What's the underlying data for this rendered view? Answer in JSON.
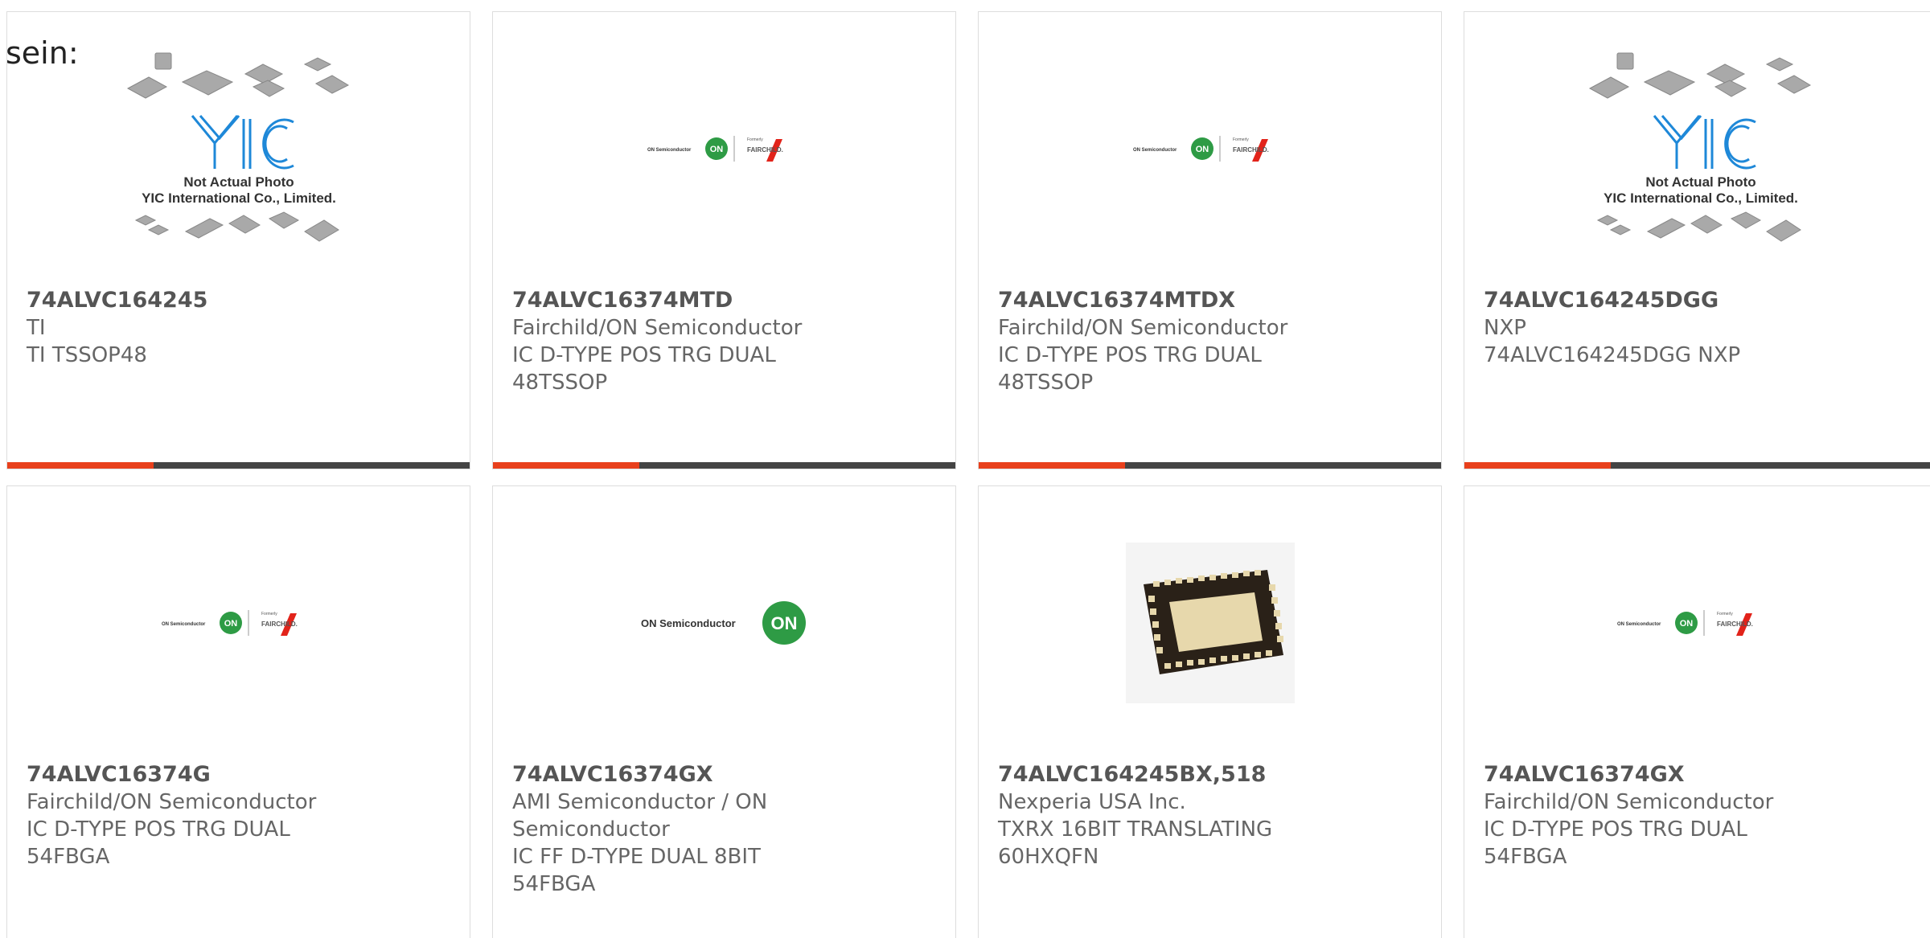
{
  "header": {
    "label": "sein:"
  },
  "placeholder": {
    "logo_text": "YIC",
    "line1": "Not Actual Photo",
    "line2": "YIC International Co., Limited."
  },
  "on_logo": {
    "company": "ON Semiconductor",
    "badge": "ON",
    "formerly": "Formerly",
    "fairchild": "FAIRCHILD."
  },
  "colors": {
    "accent": "#e8401c",
    "bar": "#444444",
    "on_green": "#2e9b45",
    "fairchild_red": "#e2231a"
  },
  "products": [
    {
      "part": "74ALVC164245",
      "maker": "TI",
      "desc": "TI TSSOP48",
      "image": "yic-placeholder"
    },
    {
      "part": "74ALVC16374MTD",
      "maker": "Fairchild/ON Semiconductor",
      "desc": "IC D-TYPE POS TRG DUAL 48TSSOP",
      "image": "on-fairchild-logo"
    },
    {
      "part": "74ALVC16374MTDX",
      "maker": "Fairchild/ON Semiconductor",
      "desc": "IC D-TYPE POS TRG DUAL 48TSSOP",
      "image": "on-fairchild-logo"
    },
    {
      "part": "74ALVC164245DGG",
      "maker": "NXP",
      "desc": "74ALVC164245DGG NXP",
      "image": "yic-placeholder"
    },
    {
      "part": "74ALVC16374G",
      "maker": "Fairchild/ON Semiconductor",
      "desc": "IC D-TYPE POS TRG DUAL 54FBGA",
      "image": "on-fairchild-logo"
    },
    {
      "part": "74ALVC16374GX",
      "maker": "AMI Semiconductor / ON Semiconductor",
      "desc": "IC FF D-TYPE DUAL 8BIT 54FBGA",
      "image": "on-semiconductor-logo"
    },
    {
      "part": "74ALVC164245BX,518",
      "maker": "Nexperia USA Inc.",
      "desc": "TXRX 16BIT TRANSLATING 60HXQFN",
      "image": "hxqfn-chip"
    },
    {
      "part": "74ALVC16374GX",
      "maker": "Fairchild/ON Semiconductor",
      "desc": "IC D-TYPE POS TRG DUAL 54FBGA",
      "image": "on-fairchild-logo"
    }
  ]
}
